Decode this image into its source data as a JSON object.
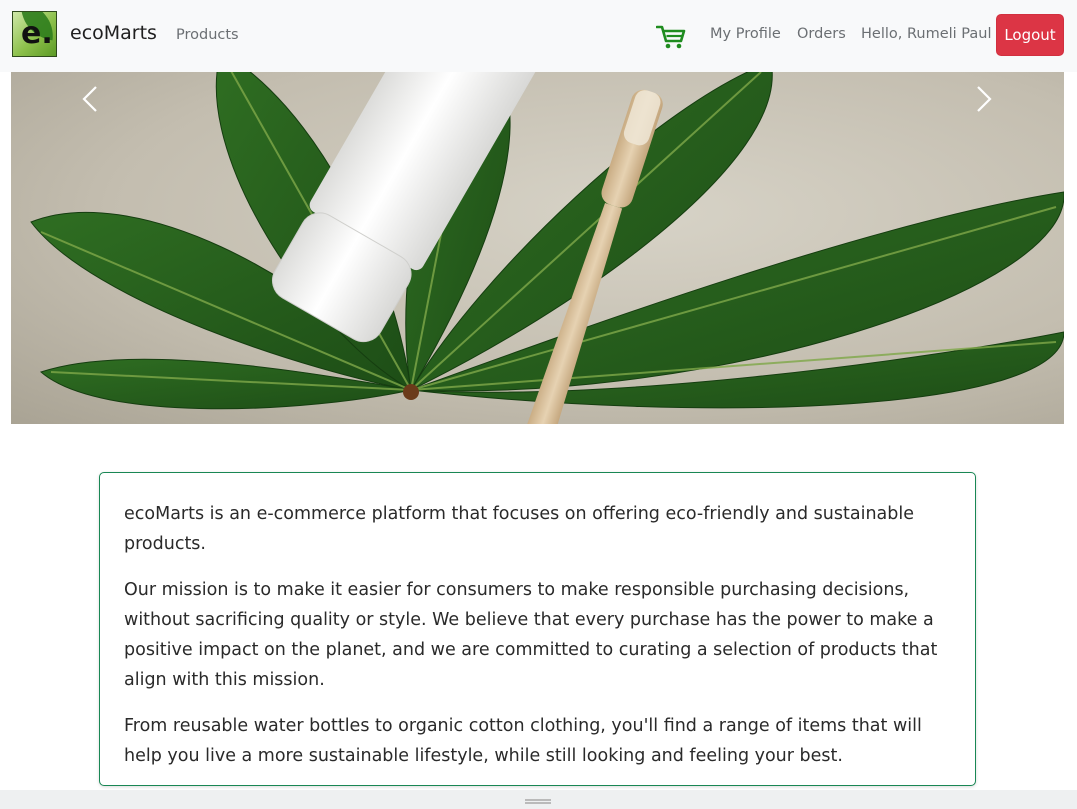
{
  "nav": {
    "logo_letter": "e.",
    "brand": "ecoMarts",
    "products": "Products",
    "cart_icon": "shopping-cart-icon",
    "my_profile": "My Profile",
    "orders": "Orders",
    "greeting": "Hello, Rumeli Paul",
    "logout": "Logout"
  },
  "carousel": {
    "prev_icon": "chevron-left-icon",
    "next_icon": "chevron-right-icon"
  },
  "about": {
    "paragraphs": [
      "ecoMarts is an e-commerce platform that focuses on offering eco-friendly and sustainable products.",
      "Our mission is to make it easier for consumers to make responsible purchasing decisions, without sacrificing quality or style. We believe that every purchase has the power to make a positive impact on the planet, and we are committed to curating a selection of products that align with this mission.",
      "From reusable water bottles to organic cotton clothing, you'll find a range of items that will help you live a more sustainable lifestyle, while still looking and feeling your best."
    ]
  },
  "colors": {
    "logout_bg": "#dc3545",
    "card_border": "#198754",
    "cart_icon": "#1f8c1f"
  }
}
